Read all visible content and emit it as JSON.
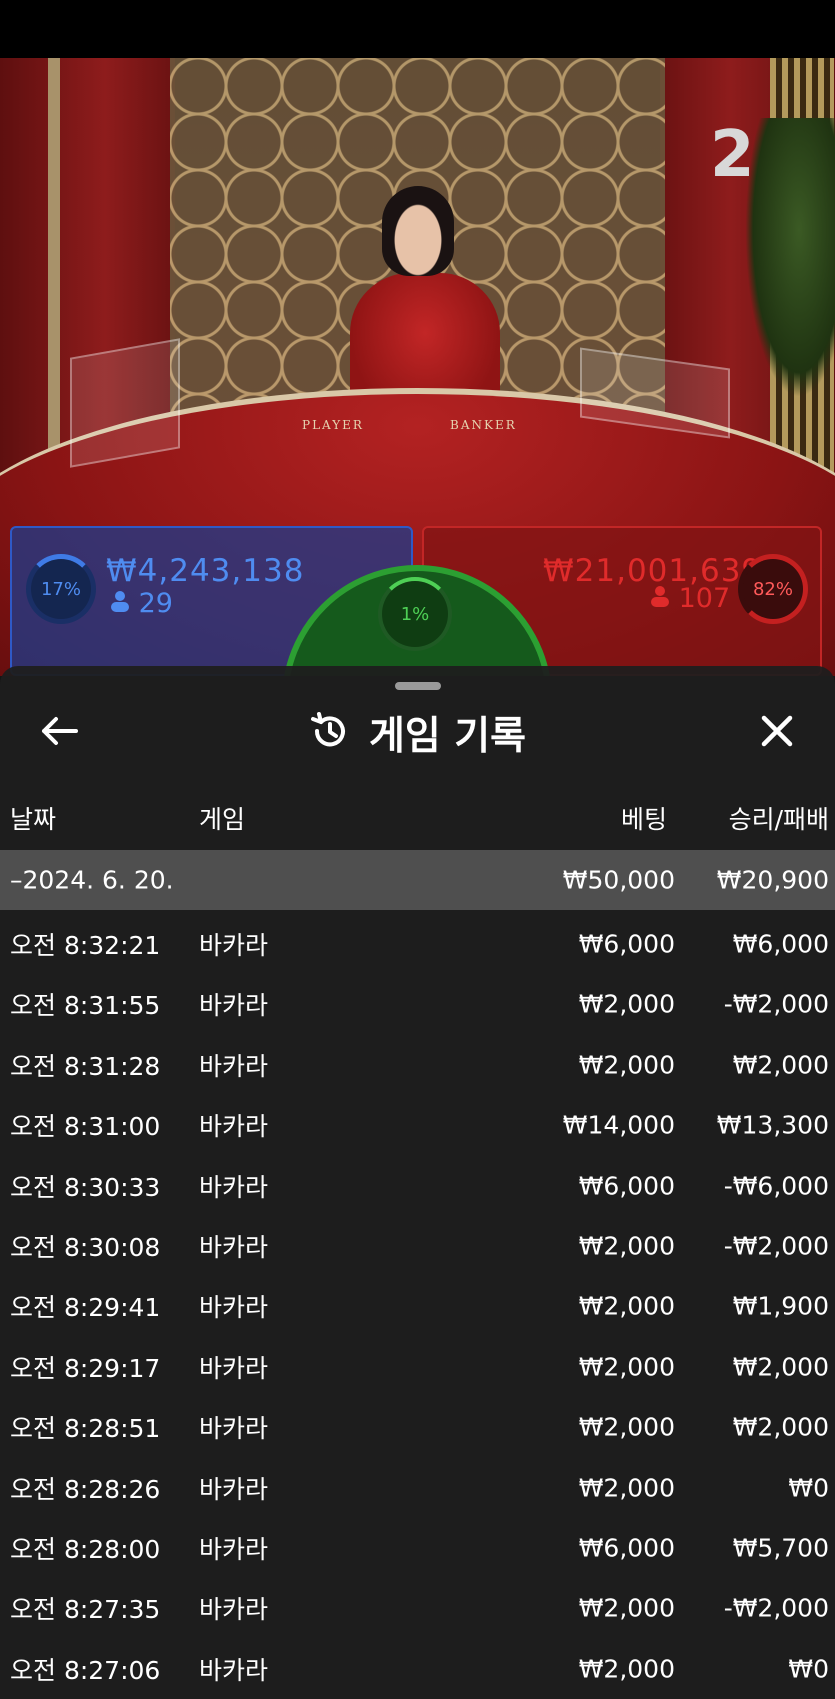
{
  "table": {
    "round_number": "2",
    "player_label": "PLAYER",
    "banker_label": "BANKER"
  },
  "bets": {
    "player": {
      "percent": "17%",
      "amount": "₩4,243,138",
      "count": "29"
    },
    "banker": {
      "percent": "82%",
      "amount": "₩21,001,639",
      "count": "107"
    },
    "tie": {
      "percent": "1%"
    }
  },
  "history": {
    "title": "게임 기록",
    "columns": {
      "date": "날짜",
      "game": "게임",
      "bet": "베팅",
      "result": "승리/패배"
    },
    "group": {
      "date": "–2024. 6. 20.",
      "bet": "₩50,000",
      "result": "₩20,900"
    },
    "rows": [
      {
        "time": "오전 8:32:21",
        "game": "바카라",
        "bet": "₩6,000",
        "result": "₩6,000"
      },
      {
        "time": "오전 8:31:55",
        "game": "바카라",
        "bet": "₩2,000",
        "result": "-₩2,000"
      },
      {
        "time": "오전 8:31:28",
        "game": "바카라",
        "bet": "₩2,000",
        "result": "₩2,000"
      },
      {
        "time": "오전 8:31:00",
        "game": "바카라",
        "bet": "₩14,000",
        "result": "₩13,300"
      },
      {
        "time": "오전 8:30:33",
        "game": "바카라",
        "bet": "₩6,000",
        "result": "-₩6,000"
      },
      {
        "time": "오전 8:30:08",
        "game": "바카라",
        "bet": "₩2,000",
        "result": "-₩2,000"
      },
      {
        "time": "오전 8:29:41",
        "game": "바카라",
        "bet": "₩2,000",
        "result": "₩1,900"
      },
      {
        "time": "오전 8:29:17",
        "game": "바카라",
        "bet": "₩2,000",
        "result": "₩2,000"
      },
      {
        "time": "오전 8:28:51",
        "game": "바카라",
        "bet": "₩2,000",
        "result": "₩2,000"
      },
      {
        "time": "오전 8:28:26",
        "game": "바카라",
        "bet": "₩2,000",
        "result": "₩0"
      },
      {
        "time": "오전 8:28:00",
        "game": "바카라",
        "bet": "₩6,000",
        "result": "₩5,700"
      },
      {
        "time": "오전 8:27:35",
        "game": "바카라",
        "bet": "₩2,000",
        "result": "-₩2,000"
      },
      {
        "time": "오전 8:27:06",
        "game": "바카라",
        "bet": "₩2,000",
        "result": "₩0"
      }
    ]
  },
  "icons": {
    "back": "arrow-left-icon",
    "history": "history-icon",
    "close": "close-icon",
    "user": "user-icon"
  },
  "colors": {
    "player": "#3f7be6",
    "banker": "#e02b2b",
    "tie": "#4ecf55",
    "panel": "#1e1e1e"
  }
}
